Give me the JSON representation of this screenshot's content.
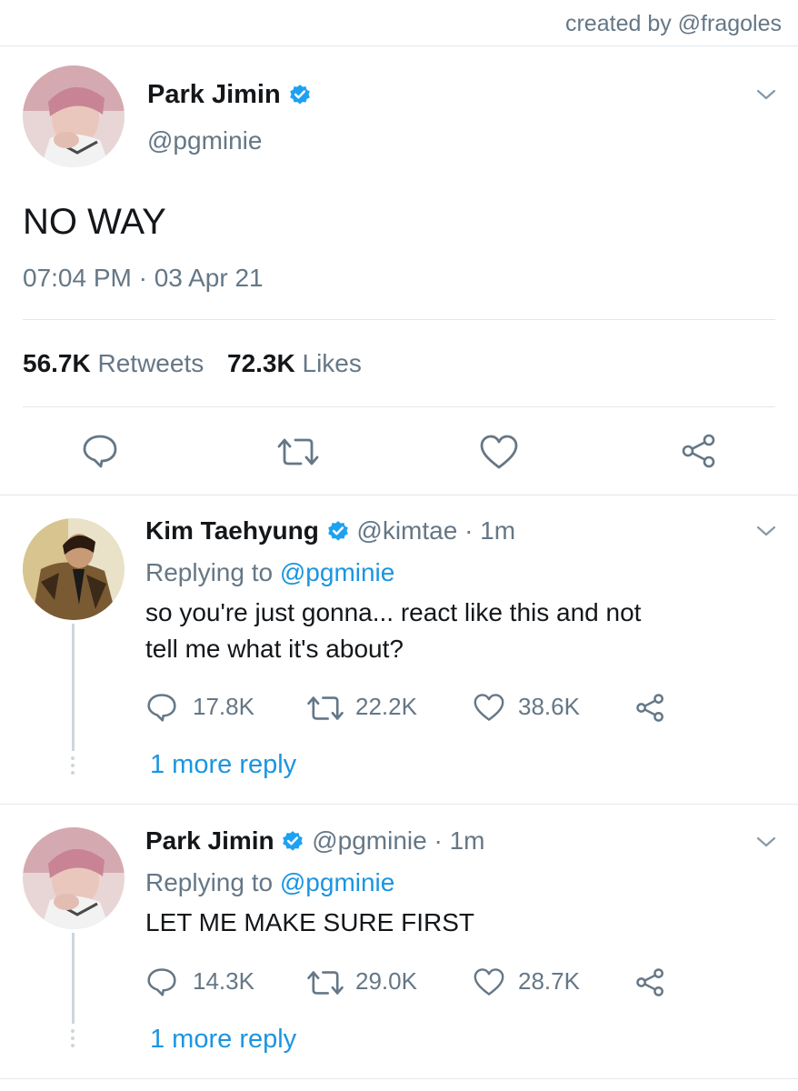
{
  "watermark": "created by @fragoles",
  "main_tweet": {
    "name": "Park Jimin",
    "handle": "@pgminie",
    "text": "NO WAY",
    "timestamp": "07:04 PM · 03 Apr 21",
    "retweets_count": "56.7K",
    "retweets_label": "Retweets",
    "likes_count": "72.3K",
    "likes_label": "Likes"
  },
  "replies": [
    {
      "name": "Kim Taehyung",
      "handle_time": "@kimtae · 1m",
      "replying_label": "Replying to",
      "replying_handle": "@pgminie",
      "text_line1": "so you're just gonna... react like this and not",
      "text_line2": "tell me what it's about?",
      "reply_count": "17.8K",
      "retweet_count": "22.2K",
      "like_count": "38.6K",
      "more_replies": "1 more reply"
    },
    {
      "name": "Park Jimin",
      "handle_time": "@pgminie · 1m",
      "replying_label": "Replying to",
      "replying_handle": "@pgminie",
      "text_line1": "LET ME MAKE SURE FIRST",
      "reply_count": "14.3K",
      "retweet_count": "29.0K",
      "like_count": "28.7K",
      "more_replies": "1 more reply"
    }
  ],
  "colors": {
    "link_blue": "#1b95e0",
    "verified_blue": "#1da1f2",
    "muted_gray": "#657786",
    "divider": "#e1e8ed"
  },
  "icons": [
    "chevron-down-icon",
    "verified-icon",
    "reply-icon",
    "retweet-icon",
    "like-icon",
    "share-icon"
  ]
}
